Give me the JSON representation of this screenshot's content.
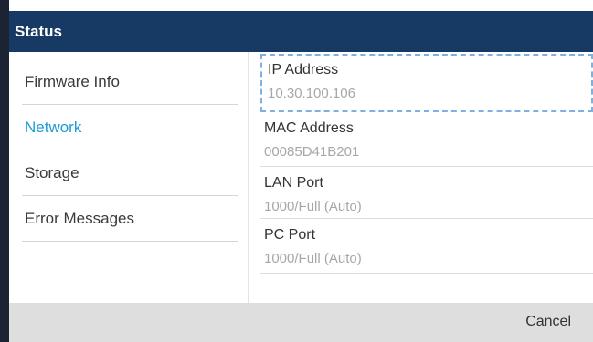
{
  "title": "Status",
  "sidebar": {
    "items": [
      {
        "label": "Firmware Info"
      },
      {
        "label": "Network",
        "active": true
      },
      {
        "label": "Storage"
      },
      {
        "label": "Error Messages"
      }
    ]
  },
  "details": [
    {
      "label": "IP Address",
      "value": "10.30.100.106",
      "focused": true
    },
    {
      "label": "MAC Address",
      "value": "00085D41B201"
    },
    {
      "label": "LAN Port",
      "value": "1000/Full (Auto)"
    },
    {
      "label": "PC Port",
      "value": "1000/Full (Auto)"
    }
  ],
  "footer": {
    "cancel_label": "Cancel"
  },
  "colors": {
    "titlebar": "#163a63",
    "active_item": "#1b9bd8",
    "footer": "#dedede"
  }
}
